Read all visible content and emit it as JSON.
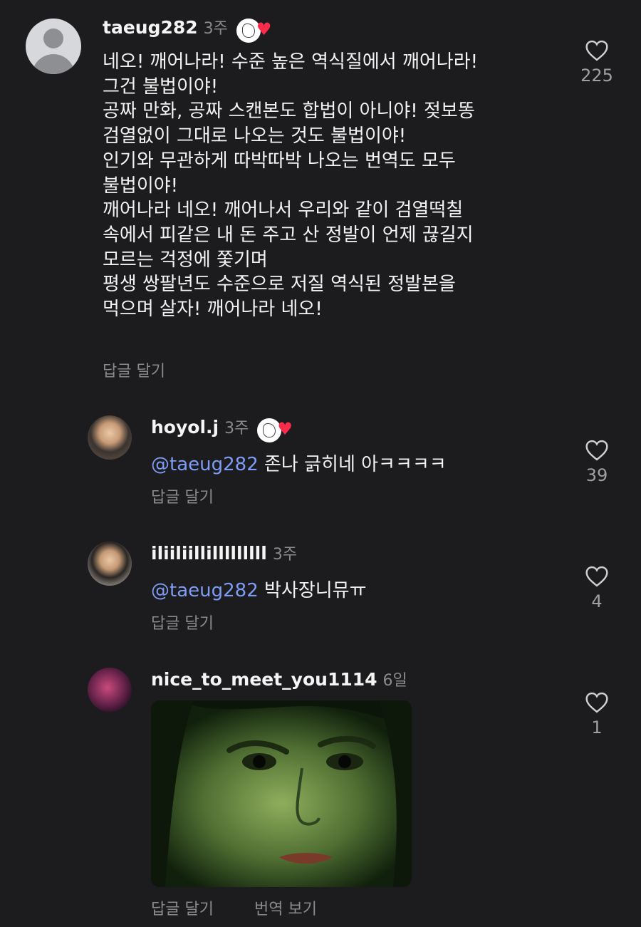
{
  "comments": [
    {
      "username": "taeug282",
      "time": "3주",
      "text": "네오! 깨어나라! 수준 높은 역식질에서 깨어나라!\n그건 불법이야!\n공짜 만화, 공짜 스캔본도 합법이 아니야! 젖보똥\n검열없이 그대로 나오는 것도 불법이야!\n인기와 무관하게 따박따박 나오는 번역도 모두\n불법이야!\n깨어나라 네오! 깨어나서 우리와 같이 검열떡칠\n속에서 피같은 내 돈 주고 산 정발이 언제 끊길지\n모르는 걱정에 쫓기며\n평생 쌍팔년도 수준으로 저질 역식된 정발본을\n먹으며 살자! 깨어나라 네오!",
      "reply_label": "답글 달기",
      "likes": "225"
    },
    {
      "username": "hoyol.j",
      "time": "3주",
      "mention": "@taeug282",
      "text": " 존나 긁히네 아ㅋㅋㅋㅋ",
      "reply_label": "답글 달기",
      "likes": "39"
    },
    {
      "username": "iliiliillilllllllll",
      "time": "3주",
      "mention": "@taeug282",
      "text": " 박사장니뮤ㅠ",
      "reply_label": "답글 달기",
      "likes": "4"
    },
    {
      "username": "nice_to_meet_you1114",
      "time": "6일",
      "reply_label": "답글 달기",
      "translate_label": "번역 보기",
      "likes": "1"
    }
  ],
  "colors": {
    "background": "#1c1c1e",
    "mention": "#7f9cf5",
    "muted": "#8a8a8e",
    "heart_badge": "#ff2b4a"
  }
}
